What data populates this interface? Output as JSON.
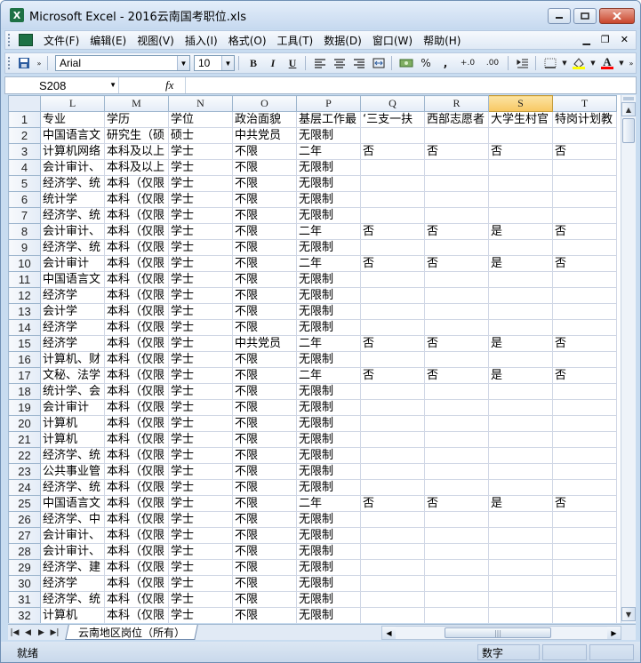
{
  "window": {
    "title": "Microsoft Excel - 2016云南国考职位.xls",
    "app_icon": "X"
  },
  "menu": {
    "items": [
      "文件(F)",
      "编辑(E)",
      "视图(V)",
      "插入(I)",
      "格式(O)",
      "工具(T)",
      "数据(D)",
      "窗口(W)",
      "帮助(H)"
    ]
  },
  "toolbar": {
    "font_name": "Arial",
    "font_size": "10",
    "bold": "B",
    "italic": "I",
    "underline": "U",
    "percent": "%",
    "comma": ",",
    "inc_decimal": "+.0",
    "dec_decimal": ".00",
    "font_color_letter": "A"
  },
  "formula_bar": {
    "name_box": "S208",
    "fx_label": "fx",
    "formula": ""
  },
  "columns": [
    "L",
    "M",
    "N",
    "O",
    "P",
    "Q",
    "R",
    "S",
    "T"
  ],
  "active_column": "S",
  "rows": [
    {
      "n": "1",
      "c": [
        "专业",
        "学历",
        "学位",
        "政治面貌",
        "基层工作最",
        "‘三支一扶",
        "西部志愿者",
        "大学生村官",
        "特岗计划教"
      ]
    },
    {
      "n": "2",
      "c": [
        "中国语言文",
        "研究生（硕",
        "硕士",
        "中共党员",
        "无限制",
        "",
        "",
        "",
        ""
      ]
    },
    {
      "n": "3",
      "c": [
        "计算机网络",
        "本科及以上",
        "学士",
        "不限",
        "二年",
        "否",
        "否",
        "否",
        "否"
      ]
    },
    {
      "n": "4",
      "c": [
        "会计审计、",
        "本科及以上",
        "学士",
        "不限",
        "无限制",
        "",
        "",
        "",
        ""
      ]
    },
    {
      "n": "5",
      "c": [
        "经济学、统",
        "本科（仅限",
        "学士",
        "不限",
        "无限制",
        "",
        "",
        "",
        ""
      ]
    },
    {
      "n": "6",
      "c": [
        "统计学",
        "本科（仅限",
        "学士",
        "不限",
        "无限制",
        "",
        "",
        "",
        ""
      ]
    },
    {
      "n": "7",
      "c": [
        "经济学、统",
        "本科（仅限",
        "学士",
        "不限",
        "无限制",
        "",
        "",
        "",
        ""
      ]
    },
    {
      "n": "8",
      "c": [
        "会计审计、",
        "本科（仅限",
        "学士",
        "不限",
        "二年",
        "否",
        "否",
        "是",
        "否"
      ]
    },
    {
      "n": "9",
      "c": [
        "经济学、统",
        "本科（仅限",
        "学士",
        "不限",
        "无限制",
        "",
        "",
        "",
        ""
      ]
    },
    {
      "n": "10",
      "c": [
        "会计审计",
        "本科（仅限",
        "学士",
        "不限",
        "二年",
        "否",
        "否",
        "是",
        "否"
      ]
    },
    {
      "n": "11",
      "c": [
        "中国语言文",
        "本科（仅限",
        "学士",
        "不限",
        "无限制",
        "",
        "",
        "",
        ""
      ]
    },
    {
      "n": "12",
      "c": [
        "经济学",
        "本科（仅限",
        "学士",
        "不限",
        "无限制",
        "",
        "",
        "",
        ""
      ]
    },
    {
      "n": "13",
      "c": [
        "会计学",
        "本科（仅限",
        "学士",
        "不限",
        "无限制",
        "",
        "",
        "",
        ""
      ]
    },
    {
      "n": "14",
      "c": [
        "经济学",
        "本科（仅限",
        "学士",
        "不限",
        "无限制",
        "",
        "",
        "",
        ""
      ]
    },
    {
      "n": "15",
      "c": [
        "经济学",
        "本科（仅限",
        "学士",
        "中共党员",
        "二年",
        "否",
        "否",
        "是",
        "否"
      ]
    },
    {
      "n": "16",
      "c": [
        "计算机、财",
        "本科（仅限",
        "学士",
        "不限",
        "无限制",
        "",
        "",
        "",
        ""
      ]
    },
    {
      "n": "17",
      "c": [
        "文秘、法学",
        "本科（仅限",
        "学士",
        "不限",
        "二年",
        "否",
        "否",
        "是",
        "否"
      ]
    },
    {
      "n": "18",
      "c": [
        "统计学、会",
        "本科（仅限",
        "学士",
        "不限",
        "无限制",
        "",
        "",
        "",
        ""
      ]
    },
    {
      "n": "19",
      "c": [
        "会计审计",
        "本科（仅限",
        "学士",
        "不限",
        "无限制",
        "",
        "",
        "",
        ""
      ]
    },
    {
      "n": "20",
      "c": [
        "计算机",
        "本科（仅限",
        "学士",
        "不限",
        "无限制",
        "",
        "",
        "",
        ""
      ]
    },
    {
      "n": "21",
      "c": [
        "计算机",
        "本科（仅限",
        "学士",
        "不限",
        "无限制",
        "",
        "",
        "",
        ""
      ]
    },
    {
      "n": "22",
      "c": [
        "经济学、统",
        "本科（仅限",
        "学士",
        "不限",
        "无限制",
        "",
        "",
        "",
        ""
      ]
    },
    {
      "n": "23",
      "c": [
        "公共事业管",
        "本科（仅限",
        "学士",
        "不限",
        "无限制",
        "",
        "",
        "",
        ""
      ]
    },
    {
      "n": "24",
      "c": [
        "经济学、统",
        "本科（仅限",
        "学士",
        "不限",
        "无限制",
        "",
        "",
        "",
        ""
      ]
    },
    {
      "n": "25",
      "c": [
        "中国语言文",
        "本科（仅限",
        "学士",
        "不限",
        "二年",
        "否",
        "否",
        "是",
        "否"
      ]
    },
    {
      "n": "26",
      "c": [
        "经济学、中",
        "本科（仅限",
        "学士",
        "不限",
        "无限制",
        "",
        "",
        "",
        ""
      ]
    },
    {
      "n": "27",
      "c": [
        "会计审计、",
        "本科（仅限",
        "学士",
        "不限",
        "无限制",
        "",
        "",
        "",
        ""
      ]
    },
    {
      "n": "28",
      "c": [
        "会计审计、",
        "本科（仅限",
        "学士",
        "不限",
        "无限制",
        "",
        "",
        "",
        ""
      ]
    },
    {
      "n": "29",
      "c": [
        "经济学、建",
        "本科（仅限",
        "学士",
        "不限",
        "无限制",
        "",
        "",
        "",
        ""
      ]
    },
    {
      "n": "30",
      "c": [
        "经济学",
        "本科（仅限",
        "学士",
        "不限",
        "无限制",
        "",
        "",
        "",
        ""
      ]
    },
    {
      "n": "31",
      "c": [
        "经济学、统",
        "本科（仅限",
        "学士",
        "不限",
        "无限制",
        "",
        "",
        "",
        ""
      ]
    },
    {
      "n": "32",
      "c": [
        "计算机",
        "本科（仅限",
        "学士",
        "不限",
        "无限制",
        "",
        "",
        "",
        ""
      ]
    }
  ],
  "sheet_tab": "云南地区岗位（所有）",
  "status": {
    "ready": "就绪",
    "mode": "数字"
  },
  "colors": {
    "active_header": "#f8c762",
    "grid_line": "#d0d7e5",
    "header_bg": "#e4ecf7",
    "excel_green": "#1e7145"
  }
}
